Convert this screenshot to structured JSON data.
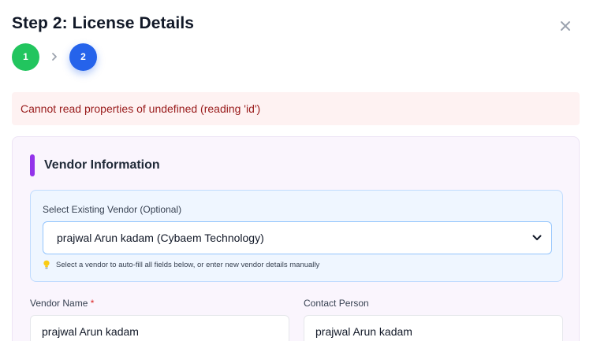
{
  "modal": {
    "title": "Step 2: License Details"
  },
  "icons": {
    "close": "close-icon",
    "chevron": "chevron-right-icon",
    "select": "chevron-down-icon",
    "hint": "lightbulb-icon"
  },
  "stepper": {
    "steps": [
      {
        "label": "1",
        "state": "complete",
        "color": "#22c55e"
      },
      {
        "label": "2",
        "state": "active",
        "color": "#2563eb"
      }
    ]
  },
  "error": {
    "message": "Cannot read properties of undefined (reading 'id')",
    "color": "#991b1b"
  },
  "vendor_section": {
    "title": "Vendor Information",
    "accent_color": "#9333ea",
    "select_label": "Select Existing Vendor (Optional)",
    "selected_vendor": "prajwal Arun kadam (Cybaem Technology)",
    "hint": "Select a vendor to auto-fill all fields below, or enter new vendor details manually"
  },
  "fields": {
    "vendor_name": {
      "label": "Vendor Name",
      "required_mark": "*",
      "value": "prajwal Arun kadam"
    },
    "contact_person": {
      "label": "Contact Person",
      "value": "prajwal Arun kadam"
    }
  }
}
